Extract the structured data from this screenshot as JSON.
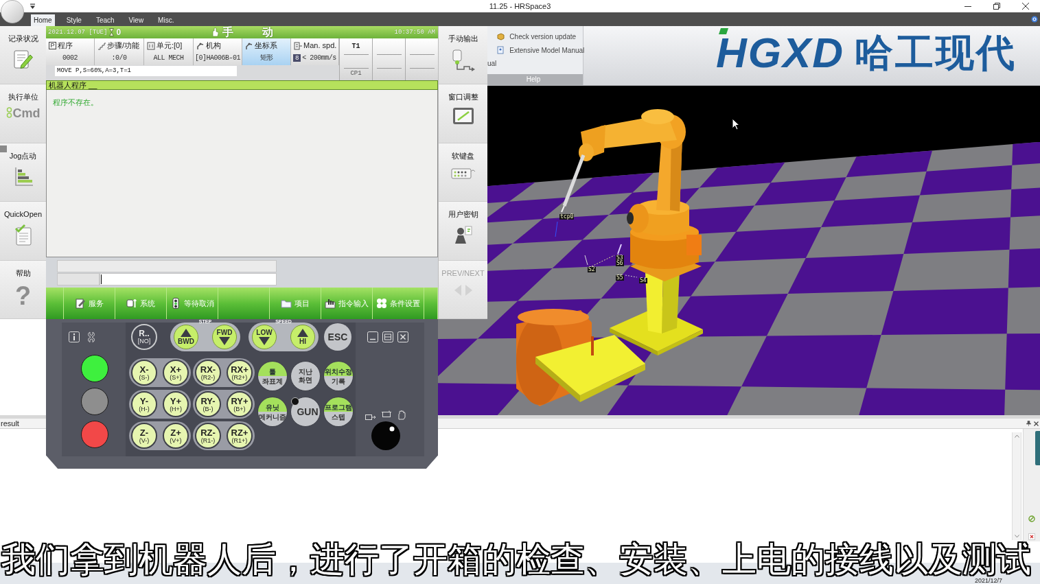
{
  "window": {
    "title": "11.25 - HRSpace3"
  },
  "ribbon": {
    "tabs": [
      {
        "label": "Home",
        "selected": true
      },
      {
        "label": "Style",
        "selected": false
      },
      {
        "label": "Teach",
        "selected": false
      },
      {
        "label": "View",
        "selected": false
      },
      {
        "label": "Misc.",
        "selected": false
      }
    ],
    "help_group": {
      "cut_label": "ual",
      "items": [
        {
          "label": "Check version update"
        },
        {
          "label": "Extensive Model Manual"
        }
      ],
      "title": "Help"
    },
    "logo": {
      "mark": "HGXD",
      "name": "哈工现代"
    }
  },
  "pendant": {
    "left_menu": [
      {
        "label": "记录状况"
      },
      {
        "label": "执行单位",
        "icon_text": "Cmd"
      },
      {
        "label": "Jog点动"
      },
      {
        "label": "QuickOpen"
      },
      {
        "label": "帮助",
        "icon_text": "?"
      }
    ],
    "status_bar": {
      "date": "2021.12.07 [TUE]",
      "counter": "0",
      "mode": "手 动",
      "time": "10:37:50 AM"
    },
    "info_cells": [
      {
        "label": "程序",
        "icon_text": "P",
        "value": "0002",
        "selected": false
      },
      {
        "label": "步骤/功能",
        "value": ":0/0",
        "selected": false
      },
      {
        "label": "单元:[0]",
        "value": "ALL MECH",
        "selected": false
      },
      {
        "label": "机构",
        "value": "[0]HA006B-01",
        "selected": false
      },
      {
        "label": "坐标系",
        "value": "矩形",
        "selected": true
      },
      {
        "label": "Man. spd.",
        "badge": "8",
        "value": "< 200mm/s",
        "selected": false
      }
    ],
    "tool_column": {
      "top": "T1",
      "bottom": "CP1"
    },
    "command": "MOVE P,S=60%,A=3,T=1",
    "program": {
      "title": "机器人程序 __",
      "message": "程序不存在。"
    },
    "function_keys": [
      {
        "kind": "blank"
      },
      {
        "kind": "key",
        "label": "服务"
      },
      {
        "kind": "key",
        "label": "系统"
      },
      {
        "kind": "key",
        "label": "等待取消"
      },
      {
        "kind": "blank"
      },
      {
        "kind": "key",
        "label": "项目"
      },
      {
        "kind": "key",
        "label": "指令输入"
      },
      {
        "kind": "key",
        "label": "条件设置"
      },
      {
        "kind": "blank"
      }
    ],
    "right_menu": [
      {
        "label": "手动输出",
        "disabled": false
      },
      {
        "label": "窗口调整",
        "disabled": false
      },
      {
        "label": "软键盘",
        "disabled": false
      },
      {
        "label": "用户密钥",
        "disabled": false
      },
      {
        "label": "PREV/NEXT",
        "disabled": true
      }
    ]
  },
  "teach_pendant": {
    "lamps": [
      {
        "color": "#3ef03e"
      },
      {
        "color": "#8e8e8e"
      },
      {
        "color": "#f24848"
      }
    ],
    "r_key": {
      "label": "R..",
      "sub": "[NO]"
    },
    "step": {
      "title": "STEP",
      "keys": [
        {
          "label": "BWD",
          "kind": "up"
        },
        {
          "label": "FWD",
          "kind": "down"
        }
      ]
    },
    "speed": {
      "title": "SPEED",
      "keys": [
        {
          "label": "LOW",
          "kind": "down"
        },
        {
          "label": "HI",
          "kind": "up"
        }
      ]
    },
    "esc": "ESC",
    "jog_keys": [
      {
        "label": "X-",
        "sub": "(S-)"
      },
      {
        "label": "X+",
        "sub": "(S+)"
      },
      {
        "label": "RX-",
        "sub": "(R2-)"
      },
      {
        "label": "RX+",
        "sub": "(R2+)"
      },
      {
        "label": "Y-",
        "sub": "(H-)"
      },
      {
        "label": "Y+",
        "sub": "(H+)"
      },
      {
        "label": "RY-",
        "sub": "(B-)"
      },
      {
        "label": "RY+",
        "sub": "(B+)"
      },
      {
        "label": "Z-",
        "sub": "(V-)"
      },
      {
        "label": "Z+",
        "sub": "(V+)"
      },
      {
        "label": "RZ-",
        "sub": "(R1-)"
      },
      {
        "label": "RZ+",
        "sub": "(R1+)"
      }
    ],
    "mode_keys": [
      {
        "kind": "split",
        "top": "툴",
        "bottom": "좌표계"
      },
      {
        "kind": "plain",
        "top": "지난",
        "bottom": "화면"
      },
      {
        "kind": "split",
        "top": "위치수정",
        "bottom": "기록"
      },
      {
        "kind": "split",
        "top": "유닛",
        "bottom": "메커니즘"
      },
      {
        "kind": "gun",
        "label": "GUN"
      },
      {
        "kind": "split",
        "top": "프로그램",
        "bottom": "스텝"
      }
    ]
  },
  "viewport": {
    "labels": [
      "tcp0",
      "S3",
      "S6",
      "S2",
      "S5",
      "S4"
    ]
  },
  "result_panel": {
    "title": "result"
  },
  "subtitle": "我们拿到机器人后，进行了开箱的检查、安装、上电的接线以及测试",
  "taskbar": {
    "date": "2021/12/7"
  }
}
